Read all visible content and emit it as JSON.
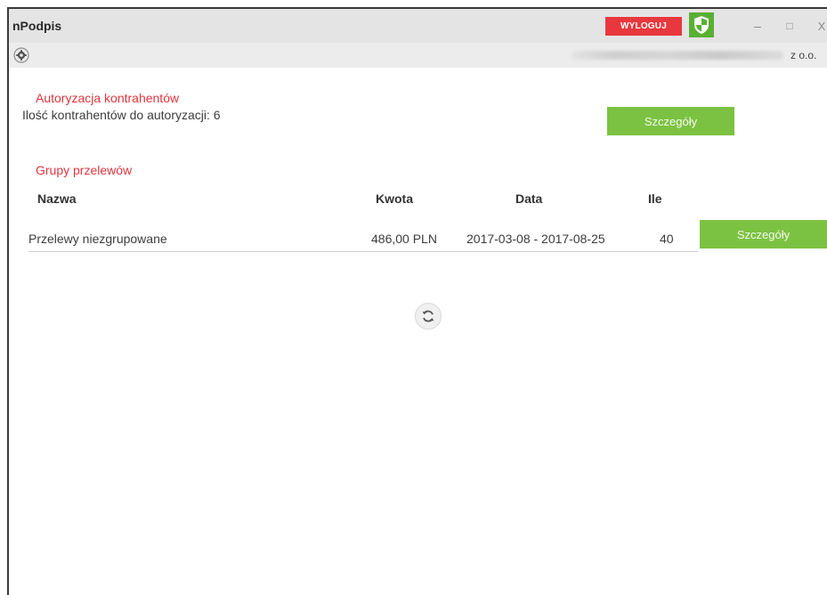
{
  "window": {
    "title": "nPodpis",
    "logout_label": "WYLOGUJ",
    "shield_icon": "shield-icon",
    "minimize": "–",
    "maximize": "□",
    "close": "X"
  },
  "toolbar": {
    "company_suffix": "z o.o."
  },
  "authorization": {
    "title": "Autoryzacja kontrahentów",
    "count_text": "Ilość kontrahentów do autoryzacji: 6",
    "details_label": "Szczegóły"
  },
  "transfer_groups": {
    "title": "Grupy przelewów",
    "columns": [
      "Nazwa",
      "Kwota",
      "Data",
      "Ile"
    ],
    "rows": [
      {
        "name": "Przelewy niezgrupowane",
        "amount": "486,00 PLN",
        "date": "2017-03-08 - 2017-08-25",
        "count": "40",
        "details_label": "Szczegóły"
      }
    ]
  },
  "colors": {
    "accent_red": "#e0363e",
    "logout_red": "#e8383d",
    "button_green": "#7cc242",
    "shield_green": "#58b033"
  }
}
